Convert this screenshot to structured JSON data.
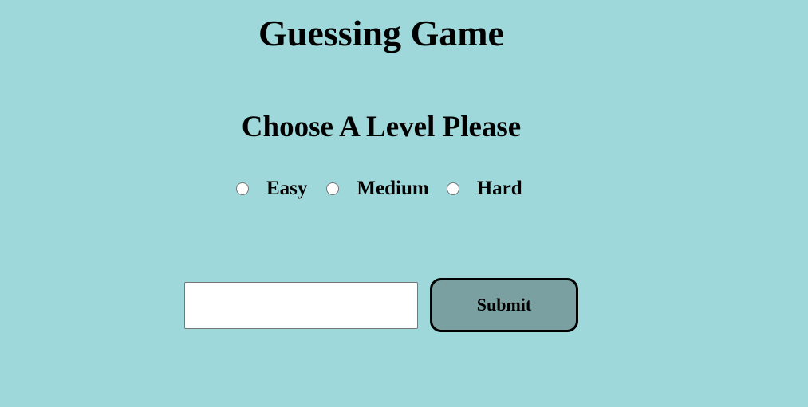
{
  "header": {
    "title": "Guessing Game"
  },
  "level_picker": {
    "prompt": "Choose A Level Please",
    "options": [
      {
        "label": "Easy",
        "selected": false
      },
      {
        "label": "Medium",
        "selected": false
      },
      {
        "label": "Hard",
        "selected": false
      }
    ]
  },
  "guess_form": {
    "input_value": "",
    "input_placeholder": "",
    "submit_label": "Submit"
  },
  "colors": {
    "background": "#9ed8da",
    "submit_button": "#7aa0a1"
  }
}
